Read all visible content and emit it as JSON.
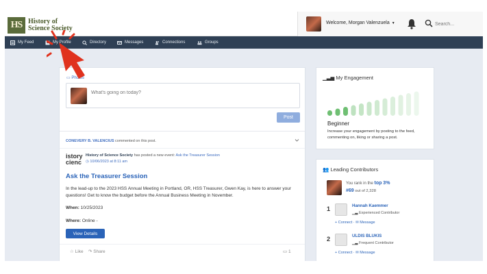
{
  "header": {
    "logo_line1": "History of",
    "logo_line2": "Science Society",
    "logo_mark": "HS",
    "welcome": "Welcome, Morgan Valenzuela",
    "search_placeholder": "Search..."
  },
  "nav": {
    "items": [
      {
        "label": "My Feed",
        "icon": "feed-icon"
      },
      {
        "label": "My Profile",
        "icon": "profile-icon"
      },
      {
        "label": "Directory",
        "icon": "search-icon"
      },
      {
        "label": "Messages",
        "icon": "messages-icon"
      },
      {
        "label": "Connections",
        "icon": "connections-icon"
      },
      {
        "label": "Groups",
        "icon": "groups-icon"
      }
    ]
  },
  "feed": {
    "photos_label": "Photos",
    "composer_placeholder": "What's going on today?",
    "post_label": "Post",
    "commenter": "CONEVERY B. VALENCIUS",
    "commented_text": "commented on this post.",
    "poster": "History of Science Society",
    "posted_text": "has posted a new event:",
    "event_link": "Ask the Treasurer Session",
    "post_date": "10/06/2023 at 8:11 am",
    "event_logo_line1": "istory",
    "event_logo_line2": "cienc",
    "event_title": "Ask the Treasurer Session",
    "event_desc": "In the lead-up to the 2023 HSS Annual Meeting in Portland, OR, HSS Treasurer, Gwen Kay, is here to answer your questions! Get to know the budget before the Annual Business Meeting in November.",
    "when_label": "When:",
    "when_value": "10/25/2023",
    "where_label": "Where:",
    "where_value": "Online -",
    "details_label": "View Details",
    "like_label": "Like",
    "share_label": "Share",
    "comment_count": "1"
  },
  "engagement": {
    "title": "My Engagement",
    "level": "Beginner",
    "description": "Increase your engagement by posting to the feed, commenting on, liking or sharing a post.",
    "active_bars": 3,
    "total_bars": 12
  },
  "contributors": {
    "title": "Leading Contributors",
    "rank_prefix": "You rank in the",
    "rank_value": "top 3%",
    "rank_number": "#69",
    "rank_suffix": "out of 2,328",
    "people": [
      {
        "rank": "1",
        "name": "Hannah Kaemmer",
        "level": "Experienced Contributor",
        "connect": "Connect",
        "message": "Message"
      },
      {
        "rank": "2",
        "name": "ULDIS BLUKIS",
        "level": "Frequent Contributor",
        "connect": "Connect",
        "message": "Message"
      }
    ]
  },
  "colors": {
    "nav_bg": "#2f4055",
    "accent": "#2a63b8",
    "engagement_active": "#6fbf73",
    "cursor": "#e0321e"
  }
}
